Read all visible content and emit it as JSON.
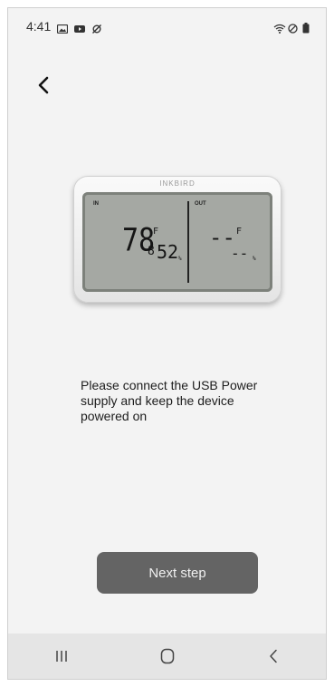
{
  "status_bar": {
    "time": "4:41",
    "left_icons": [
      "gallery-icon",
      "youtube-icon",
      "sync-off-icon"
    ],
    "right_icons": [
      "wifi-icon",
      "do-not-disturb-icon",
      "battery-icon"
    ]
  },
  "header": {
    "back_icon": "chevron-left-icon"
  },
  "device": {
    "brand": "INKBIRD",
    "in_label": "IN",
    "out_label": "OUT",
    "in_temp": "78",
    "in_temp_decimal": "8",
    "in_temp_unit": "F",
    "in_humidity": "52",
    "in_humidity_unit": "%",
    "out_temp": "--",
    "out_temp_unit": "F",
    "out_humidity": "--",
    "out_humidity_unit": "%"
  },
  "message": "Please connect the USB Power supply and keep the device powered on",
  "next_button": "Next step",
  "nav_bar": {
    "recent_icon": "recent-apps-icon",
    "home_icon": "home-icon",
    "back_icon": "back-icon"
  },
  "colors": {
    "background": "#f3f3f3",
    "button": "#646464",
    "button_text": "#f0f0f0",
    "nav_bar": "#e5e5e5"
  }
}
